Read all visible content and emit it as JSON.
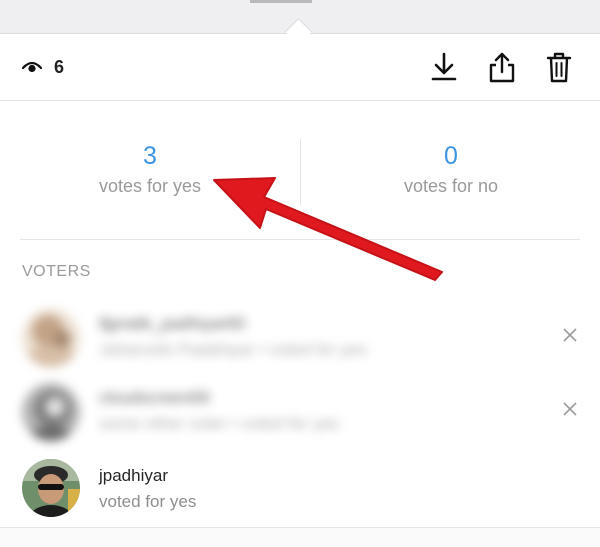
{
  "header": {
    "view_count": "6",
    "icons": [
      "eye-icon",
      "download-icon",
      "share-icon",
      "trash-icon"
    ]
  },
  "votes": {
    "yes_count": "3",
    "yes_label": "votes for yes",
    "no_count": "0",
    "no_label": "votes for no"
  },
  "voters": {
    "heading": "VOTERS",
    "list": [
      {
        "username": "lljpratik_padhiyar60",
        "status": "Jahanzeb Padahiyar • voted for yes",
        "removable": true,
        "blurred": true
      },
      {
        "username": "cloudscreen69",
        "status": "some other voter • voted for yes",
        "removable": true,
        "blurred": true
      },
      {
        "username": "jpadhiyar",
        "status": "voted for yes",
        "removable": false,
        "blurred": false
      }
    ]
  },
  "colors": {
    "accent": "#3d94e0",
    "annotation_arrow": "#e0191e",
    "secondary_text": "#9a9a9a"
  }
}
